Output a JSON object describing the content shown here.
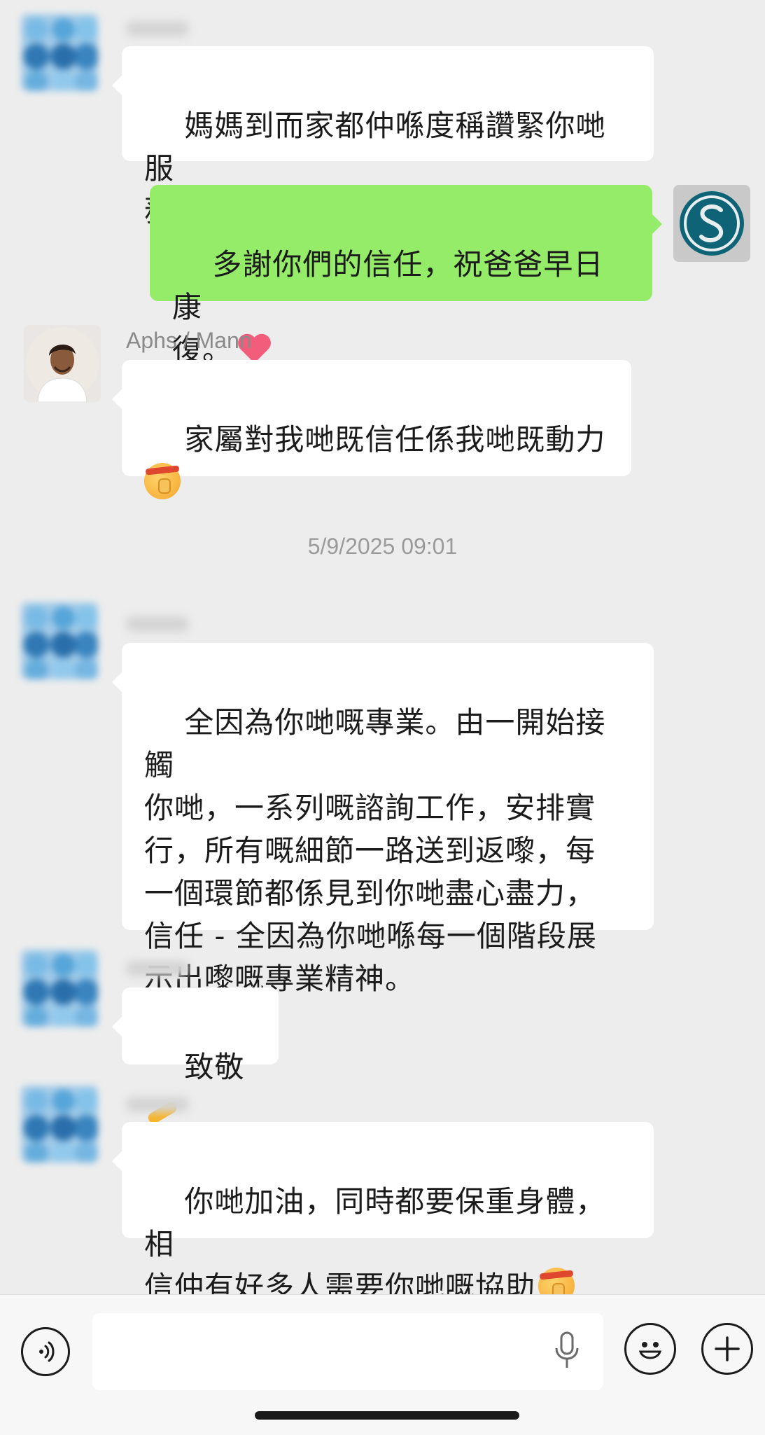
{
  "messages": [
    {
      "sender": "",
      "text": "媽媽到而家都仲喺度稱讚緊你哋服\n務專業 ",
      "emoji": [
        "hand",
        "face"
      ]
    },
    {
      "sender": "self",
      "text": "多謝你們的信任，祝爸爸早日康\n復。",
      "emoji": [
        "heart"
      ]
    },
    {
      "sender": "Aphs / Mann",
      "text": "家屬對我哋既信任係我哋既動力\n",
      "emoji": [
        "face"
      ]
    },
    {
      "sender": "",
      "text": "全因為你哋嘅專業。由一開始接觸\n你哋，一系列嘅諮詢工作，安排實\n行，所有嘅細節一路送到返嚟，每\n一個環節都係見到你哋盡心盡力，\n信任 - 全因為你哋喺每一個階段展\n示出嚟嘅專業精神。",
      "emoji": []
    },
    {
      "sender": "",
      "text": "致敬 ",
      "emoji": [
        "hand"
      ]
    },
    {
      "sender": "",
      "text": "你哋加油，同時都要保重身體，相\n信仲有好多人需要你哋嘅協助",
      "emoji": [
        "face"
      ]
    }
  ],
  "timestamp": "5/9/2025 09:01",
  "input": {
    "placeholder": "",
    "value": ""
  },
  "icons": {
    "voice": "voice-icon",
    "mic": "mic-icon",
    "emoji": "emoji-icon",
    "add": "plus-icon"
  },
  "colors": {
    "sent_bubble": "#95ec69",
    "received_bubble": "#ffffff",
    "background": "#ededed"
  }
}
